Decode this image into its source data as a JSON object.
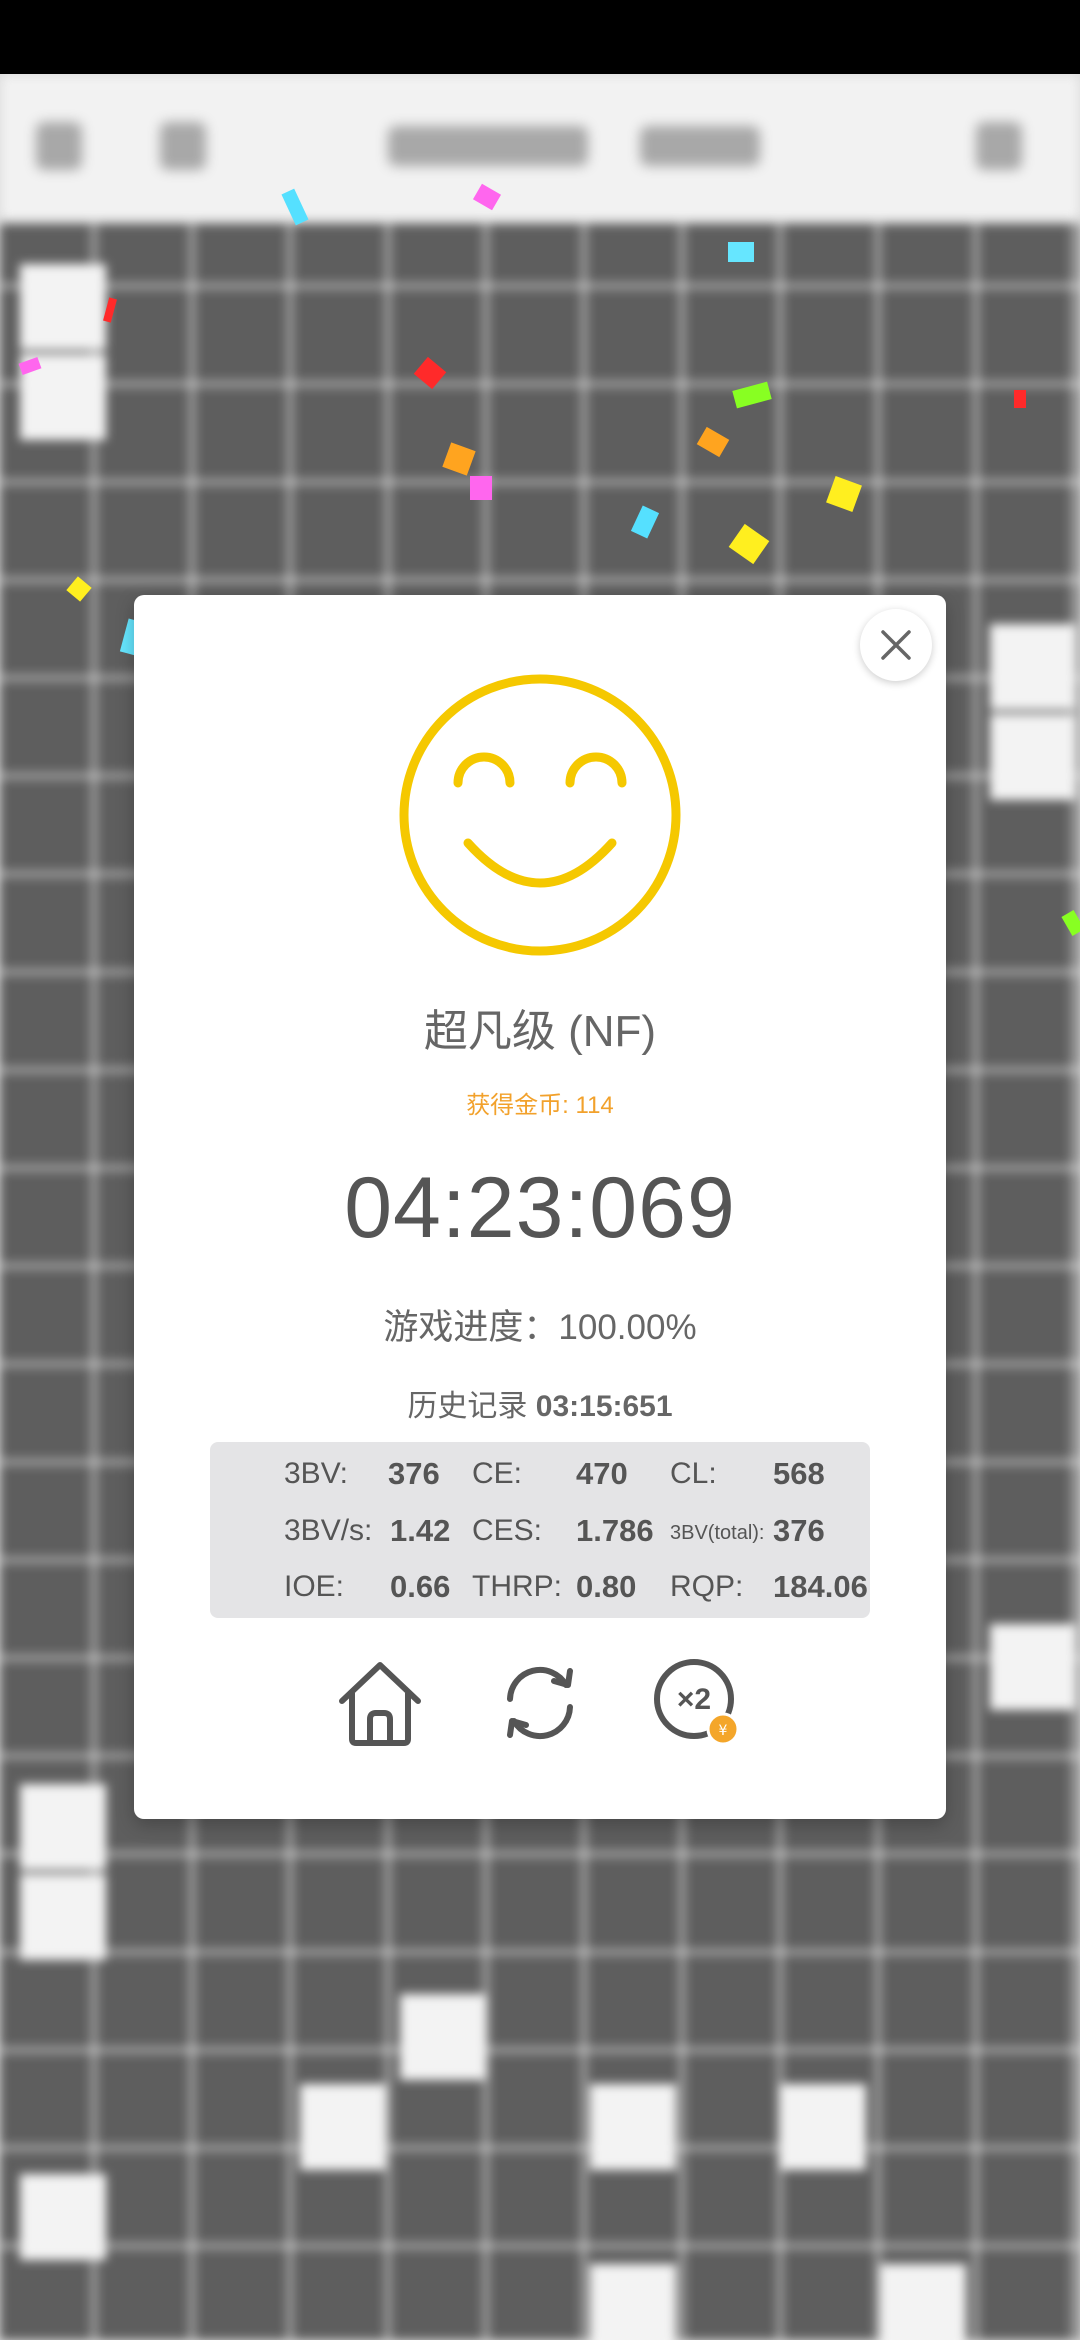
{
  "result": {
    "level": "超凡级 (NF)",
    "coins_text": "获得金币: 114",
    "time": "04:23:069",
    "progress_text": "游戏进度：100.00%",
    "record_label": "历史记录",
    "record_value": "03:15:651"
  },
  "stats": {
    "rows": [
      [
        {
          "label": "3BV:",
          "value": "376"
        },
        {
          "label": "CE:",
          "value": "470"
        },
        {
          "label": "CL:",
          "value": "568"
        }
      ],
      [
        {
          "label": "3BV/s:",
          "value": "1.42"
        },
        {
          "label": "CES:",
          "value": "1.786"
        },
        {
          "label": "3BV(total):",
          "value": "376"
        }
      ],
      [
        {
          "label": "IOE:",
          "value": "0.66"
        },
        {
          "label": "THRP:",
          "value": "0.80"
        },
        {
          "label": "RQP:",
          "value": "184.06"
        }
      ]
    ]
  },
  "icons": {
    "close": "close-icon",
    "smiley": "smiley-face-icon",
    "home": "home-icon",
    "restart": "restart-icon",
    "double": "double-coins-icon"
  },
  "colors": {
    "smiley": "#f5c800",
    "coins": "#f2a12b",
    "badge": "#f4a62a"
  }
}
